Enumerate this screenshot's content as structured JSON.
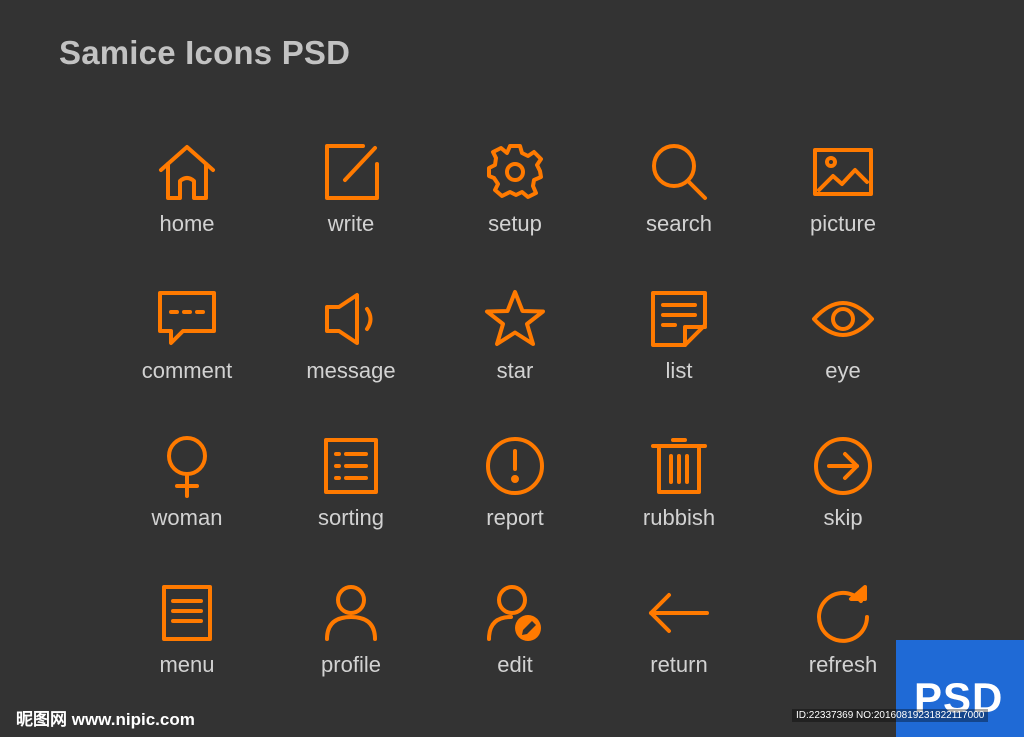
{
  "title": "Samice Icons PSD",
  "accent_color": "#ff7a00",
  "icons": [
    {
      "label": "home",
      "icon": "home-icon"
    },
    {
      "label": "write",
      "icon": "write-icon"
    },
    {
      "label": "setup",
      "icon": "gear-icon"
    },
    {
      "label": "search",
      "icon": "search-icon"
    },
    {
      "label": "picture",
      "icon": "picture-icon"
    },
    {
      "label": "comment",
      "icon": "comment-icon"
    },
    {
      "label": "message",
      "icon": "speaker-icon"
    },
    {
      "label": "star",
      "icon": "star-icon"
    },
    {
      "label": "list",
      "icon": "note-icon"
    },
    {
      "label": "eye",
      "icon": "eye-icon"
    },
    {
      "label": "woman",
      "icon": "female-icon"
    },
    {
      "label": "sorting",
      "icon": "sorting-list-icon"
    },
    {
      "label": "report",
      "icon": "exclamation-icon"
    },
    {
      "label": "rubbish",
      "icon": "trash-icon"
    },
    {
      "label": "skip",
      "icon": "arrow-right-circle-icon"
    },
    {
      "label": "menu",
      "icon": "document-icon"
    },
    {
      "label": "profile",
      "icon": "user-icon"
    },
    {
      "label": "edit",
      "icon": "user-edit-icon"
    },
    {
      "label": "return",
      "icon": "arrow-left-icon"
    },
    {
      "label": "refresh",
      "icon": "refresh-icon"
    }
  ],
  "badge": {
    "text": "PSD"
  },
  "watermark": {
    "site": "昵图网 www.nipic.com",
    "id": "ID:22337369 NO:20160819231822117000"
  }
}
